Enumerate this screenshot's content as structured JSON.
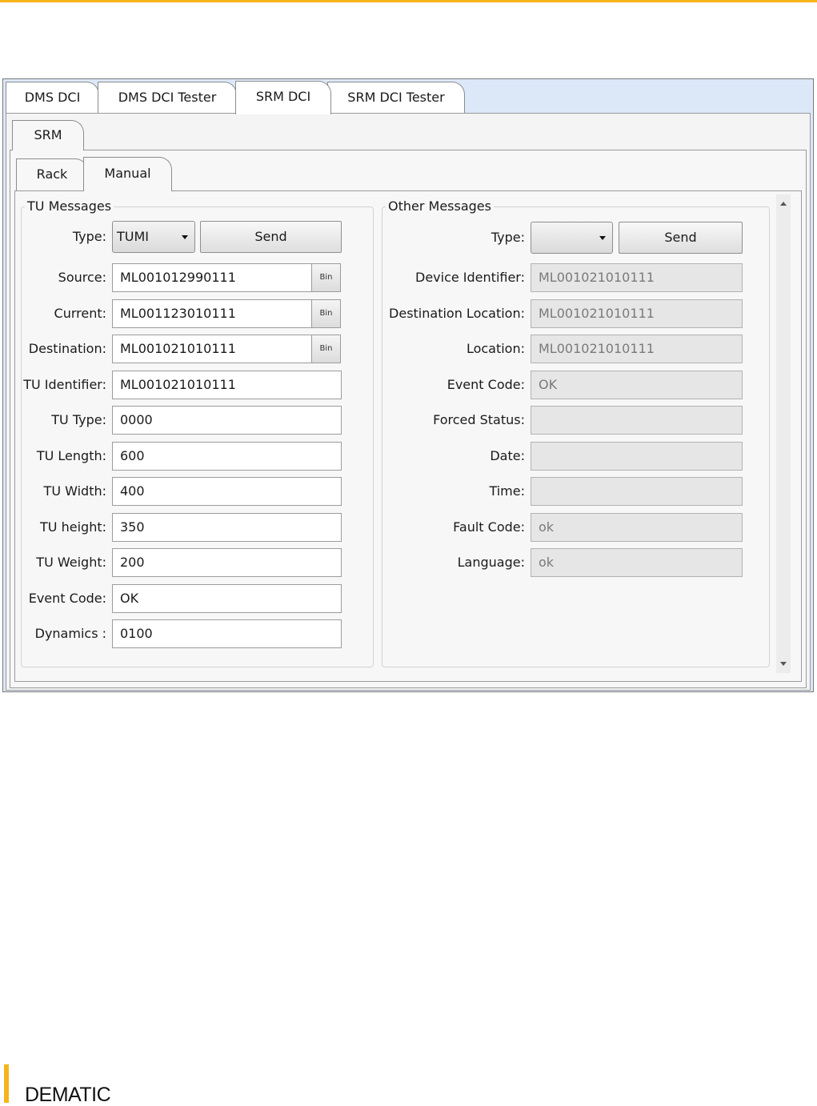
{
  "top_tabs": [
    "DMS DCI",
    "DMS DCI  Tester",
    "SRM DCI",
    "SRM DCI Tester"
  ],
  "active_top_tab": "SRM DCI",
  "srm_tab": "SRM",
  "sub_tabs": [
    "Rack",
    "Manual"
  ],
  "active_sub_tab": "Manual",
  "tu_messages": {
    "title": "TU Messages",
    "type_label": "Type:",
    "type_value": "TUMI",
    "send_label": "Send",
    "bin_label": "Bin",
    "source": {
      "label": "Source:",
      "value": "ML001012990111"
    },
    "current": {
      "label": "Current:",
      "value": "ML001123010111"
    },
    "destination": {
      "label": "Destination:",
      "value": "ML001021010111"
    },
    "tu_identifier": {
      "label": "TU Identifier:",
      "value": "ML001021010111"
    },
    "tu_type": {
      "label": "TU Type:",
      "value": "0000"
    },
    "tu_length": {
      "label": "TU Length:",
      "value": "600"
    },
    "tu_width": {
      "label": "TU Width:",
      "value": "400"
    },
    "tu_height": {
      "label": "TU height:",
      "value": "350"
    },
    "tu_weight": {
      "label": "TU Weight:",
      "value": "200"
    },
    "event_code": {
      "label": "Event Code:",
      "value": "OK"
    },
    "dynamics": {
      "label": "Dynamics :",
      "value": "0100"
    }
  },
  "other_messages": {
    "title": "Other Messages",
    "type_label": "Type:",
    "type_value": "",
    "send_label": "Send",
    "device_identifier": {
      "label": "Device Identifier:",
      "value": "ML001021010111"
    },
    "destination_location": {
      "label": "Destination Location:",
      "value": "ML001021010111"
    },
    "location": {
      "label": "Location:",
      "value": "ML001021010111"
    },
    "event_code": {
      "label": "Event Code:",
      "value": "OK"
    },
    "forced_status": {
      "label": "Forced Status:",
      "value": ""
    },
    "date": {
      "label": "Date:",
      "value": ""
    },
    "time": {
      "label": "Time:",
      "value": ""
    },
    "fault_code": {
      "label": "Fault Code:",
      "value": "ok"
    },
    "language": {
      "label": "Language:",
      "value": "ok"
    }
  },
  "brand": "DEMATIC",
  "colors": {
    "brand_accent": "#f6b41b",
    "tab_strip": "#dce8f8",
    "readonly_field": "#e6e6e6"
  }
}
